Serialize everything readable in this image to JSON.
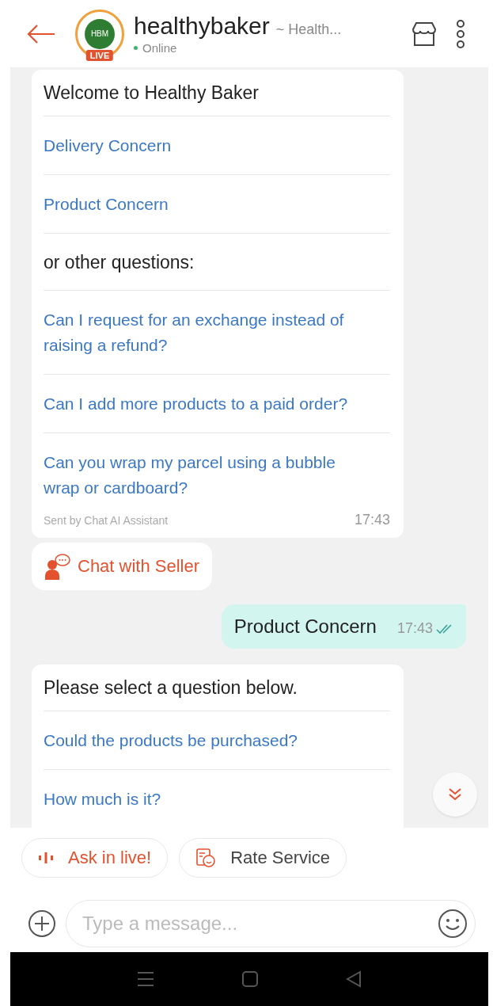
{
  "header": {
    "avatar": {
      "logo_text": "HBM",
      "badge": "LIVE"
    },
    "name": "healthybaker",
    "subtitle": "~ Health...",
    "status": "Online",
    "online": true
  },
  "messages": [
    {
      "kind": "bot_menu",
      "items": [
        {
          "kind": "title",
          "text": "Welcome to Healthy Baker"
        },
        {
          "kind": "link",
          "text": "Delivery Concern"
        },
        {
          "kind": "link",
          "text": "Product Concern"
        },
        {
          "kind": "title",
          "text": "or other questions:"
        },
        {
          "kind": "link",
          "text": "Can I request for an exchange instead of raising a refund?"
        },
        {
          "kind": "link",
          "text": "Can I add more products to a paid order?"
        },
        {
          "kind": "link",
          "text": "Can you wrap my parcel using a bubble wrap or cardboard?"
        }
      ],
      "sender": "Sent by Chat AI Assistant",
      "time": "17:43"
    },
    {
      "kind": "action",
      "label": "Chat with Seller"
    },
    {
      "kind": "user",
      "text": "Product Concern",
      "time": "17:43",
      "read": true
    },
    {
      "kind": "bot_menu",
      "items": [
        {
          "kind": "title",
          "text": "Please select a question below."
        },
        {
          "kind": "link",
          "text": "Could the products be purchased?"
        },
        {
          "kind": "link",
          "text": "How much is it?"
        }
      ]
    }
  ],
  "quick_actions": [
    {
      "kind": "live",
      "label": "Ask in live!"
    },
    {
      "kind": "rate",
      "label": "Rate Service"
    }
  ],
  "composer": {
    "placeholder": "Type a message..."
  }
}
